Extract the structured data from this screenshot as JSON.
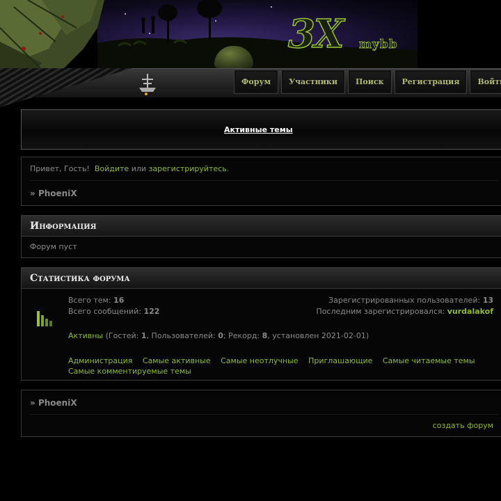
{
  "header": {
    "logo_main": "3X",
    "logo_sub": "mybb"
  },
  "nav": [
    "Форум",
    "Участники",
    "Поиск",
    "Регистрация",
    "Войти"
  ],
  "active_topics": "Активные темы",
  "greeting": {
    "prefix": "Привет, Гость!",
    "login": "Войдите",
    "or": "или",
    "register": "зарегистрируйтесь",
    "dot": "."
  },
  "breadcrumb": {
    "arrow": "»",
    "forum_name": "PhoeniX"
  },
  "info": {
    "title": "Информация",
    "text": "Форум пуст"
  },
  "stats": {
    "title": "Статистика форума",
    "topics_label": "Всего тем:",
    "topics": "16",
    "posts_label": "Всего сообщений:",
    "posts": "122",
    "users_label": "Зарегистрированных пользователей:",
    "users": "13",
    "last_label": "Последним зарегистрировался:",
    "last_user": "vurdalakof",
    "active_label": "Активны",
    "guests_label": "(Гостей:",
    "guests": "1",
    "members_label": ", Пользователей:",
    "members": "0",
    "record_label": "; Рекорд:",
    "record": "8",
    "record_date": ", установлен 2021-02-01)",
    "links": [
      "Администрация",
      "Самые активные",
      "Самые неотлучные",
      "Приглашающие",
      "Самые читаемые темы",
      "Самые комментируемые темы"
    ]
  },
  "footer": {
    "create": "создать форум"
  }
}
